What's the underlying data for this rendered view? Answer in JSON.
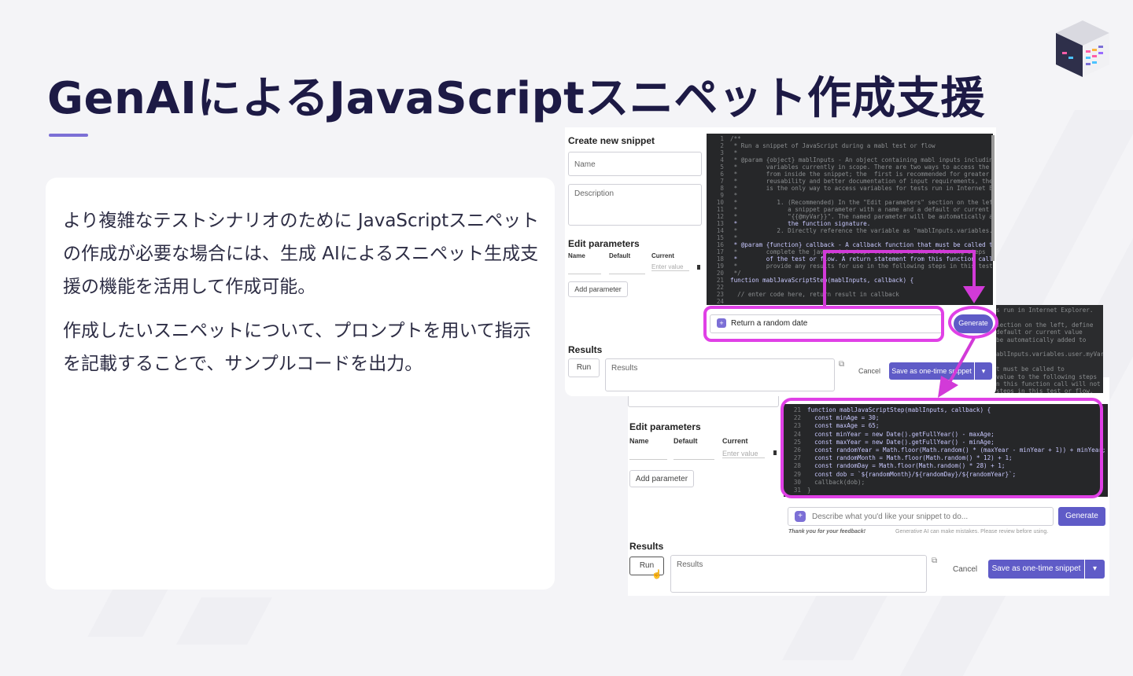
{
  "title": "GenAIによるJavaScriptスニペット作成支援",
  "body": {
    "paragraph1": "より複雑なテストシナリオのために JavaScriptスニペットの作成が必要な場合には、生成 AIによるスニペット生成支援の機能を活用して作成可能。",
    "paragraph2": "作成したいスニペットについて、プロンプトを用いて指示を記載することで、サンプルコードを出力。"
  },
  "front": {
    "heading": "Create new snippet",
    "name_placeholder": "Name",
    "description_placeholder": "Description",
    "edit_parameters": "Edit parameters",
    "col_name": "Name",
    "col_default": "Default",
    "col_current": "Current",
    "current_placeholder": "Enter value",
    "add_parameter": "Add parameter",
    "results_heading": "Results",
    "run": "Run",
    "results_placeholder": "Results",
    "cancel": "Cancel",
    "save": "Save as one-time snippet",
    "prompt_value": "Return a random date",
    "generate": "Generate"
  },
  "front_code": [
    {
      "n": "1",
      "t": "/**"
    },
    {
      "n": "2",
      "t": " * Run a snippet of JavaScript during a mabl test or flow"
    },
    {
      "n": "3",
      "t": " *"
    },
    {
      "n": "4",
      "t": " * @param {object} mablInputs - An object containing mabl inputs including"
    },
    {
      "n": "5",
      "t": " *        variables currently in scope. There are two ways to access the variables"
    },
    {
      "n": "6",
      "t": " *        from inside the snippet; the  first is recommended for greater"
    },
    {
      "n": "7",
      "t": " *        reusability and better documentation of input requirements, the second"
    },
    {
      "n": "8",
      "t": " *        is the only way to access variables for tests run in Internet Explorer."
    },
    {
      "n": "9",
      "t": " *"
    },
    {
      "n": "10",
      "t": " *           1. (Recommended) In the \"Edit parameters\" section on the left, define"
    },
    {
      "n": "11",
      "t": " *              a snippet parameter with a name and a default or current value"
    },
    {
      "n": "12",
      "t": " *              \"{{@myVar}}\". The named parameter will be automatically added to"
    },
    {
      "n": "13",
      "t": " *              the function signature."
    },
    {
      "n": "14",
      "t": " *           2. Directly reference the variable as \"mablInputs.variables.user.myVar\""
    },
    {
      "n": "15",
      "t": " *"
    },
    {
      "n": "16",
      "t": " * @param {function} callback - A callback function that must be called to"
    },
    {
      "n": "17",
      "t": " *        complete the javascript step. ...value to the following steps"
    },
    {
      "n": "18",
      "t": " *        of the test or flow. A return statement from this function call will not"
    },
    {
      "n": "19",
      "t": " *        provide any results for use in the following steps in this test or flow."
    },
    {
      "n": "20",
      "t": " */"
    },
    {
      "n": "21",
      "t": "function mablJavaScriptStep(mablInputs, callback) {"
    },
    {
      "n": "22",
      "t": ""
    },
    {
      "n": "23",
      "t": "  // enter code here, return result in callback"
    },
    {
      "n": "24",
      "t": ""
    }
  ],
  "behind_code": [
    "s run in Internet Explorer.",
    "",
    "section on the left, define",
    "default or current value",
    "be automatically added to",
    "",
    "ablInputs.variables.user.myVar",
    "",
    "t must be called to",
    "value to the following steps",
    "n this function call will not",
    "steps in this test or flow."
  ],
  "back": {
    "edit_parameters": "Edit parameters",
    "col_name": "Name",
    "col_default": "Default",
    "col_current": "Current",
    "current_placeholder": "Enter value",
    "add_parameter": "Add parameter",
    "prompt_placeholder": "Describe what you'd like your snippet to do...",
    "generate": "Generate",
    "feedback": "Thank you for your feedback!",
    "disclaimer": "Generative AI can make mistakes. Please review before using.",
    "results_heading": "Results",
    "run": "Run",
    "results_placeholder": "Results",
    "cancel": "Cancel",
    "save": "Save as one-time snippet"
  },
  "back_code": [
    {
      "n": "21",
      "t": "function mablJavaScriptStep(mablInputs, callback) {"
    },
    {
      "n": "22",
      "t": "  const minAge = 30;"
    },
    {
      "n": "23",
      "t": "  const maxAge = 65;"
    },
    {
      "n": "24",
      "t": "  const minYear = new Date().getFullYear() - maxAge;"
    },
    {
      "n": "25",
      "t": "  const maxYear = new Date().getFullYear() - minAge;"
    },
    {
      "n": "26",
      "t": "  const randomYear = Math.floor(Math.random() * (maxYear - minYear + 1)) + minYear;"
    },
    {
      "n": "27",
      "t": "  const randomMonth = Math.floor(Math.random() * 12) + 1;"
    },
    {
      "n": "28",
      "t": "  const randomDay = Math.floor(Math.random() * 28) + 1;"
    },
    {
      "n": "29",
      "t": "  const dob = `${randomMonth}/${randomDay}/${randomYear}`;"
    },
    {
      "n": "30",
      "t": "  callback(dob);"
    },
    {
      "n": "31",
      "t": "}"
    }
  ],
  "colors": {
    "accent": "#7c6fd6",
    "primary_button": "#5f5bc7",
    "highlight": "#e040e6",
    "code_bg": "#262729",
    "title": "#1d1a45"
  }
}
